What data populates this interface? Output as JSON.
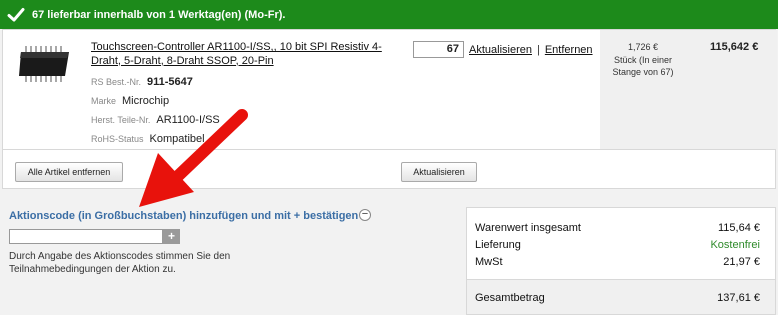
{
  "banner": {
    "text": "67 lieferbar innerhalb von 1 Werktag(en) (Mo-Fr).",
    "color": "#1d8a1b",
    "icon": "check-icon"
  },
  "item": {
    "title": "Touchscreen-Controller AR1100-I/SS,, 10 bit SPI Resistiv 4-Draht, 5-Draht, 8-Draht SSOP, 20-Pin",
    "image_icon": "ic-chip-icon",
    "rs_label": "RS Best.-Nr.",
    "rs_value": "911-5647",
    "brand_label": "Marke",
    "brand_value": "Microchip",
    "mfr_label": "Herst. Teile-Nr.",
    "mfr_value": "AR1100-I/SS",
    "rohs_label": "RoHS-Status",
    "rohs_value": "Kompatibel",
    "quantity": "67",
    "update_link": "Aktualisieren",
    "separator": "|",
    "remove_link": "Entfernen",
    "unit_price_line1": "1,726 €",
    "unit_price_line2": "Stück (In einer",
    "unit_price_line3": "Stange von 67)",
    "line_total": "115,642 €"
  },
  "buttons": {
    "remove_all": "Alle Artikel entfernen",
    "update": "Aktualisieren"
  },
  "promo": {
    "title": "Aktionscode (in Großbuchstaben) hinzufügen und mit + bestätigen",
    "collapse_symbol": "−",
    "input_value": "",
    "submit_symbol": "+",
    "note": "Durch Angabe des Aktionscodes stimmen Sie den Teilnahmebedingungen der Aktion zu."
  },
  "summary": {
    "goods_label": "Warenwert insgesamt",
    "goods_value": "115,64 €",
    "delivery_label": "Lieferung",
    "delivery_value": "Kostenfrei",
    "vat_label": "MwSt",
    "vat_value": "21,97 €",
    "total_label": "Gesamtbetrag",
    "total_value": "137,61 €"
  },
  "annotation": {
    "icon": "red-arrow-icon",
    "color": "#e8120c"
  }
}
